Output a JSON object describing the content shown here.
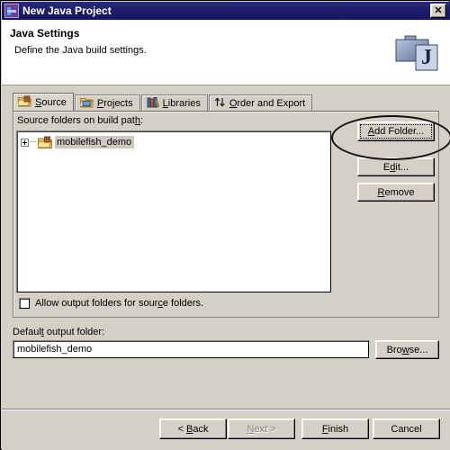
{
  "window": {
    "title": "New Java Project",
    "title_icon": "eclipse-java-icon",
    "close_label": "✕"
  },
  "banner": {
    "title": "Java Settings",
    "subtitle": "Define the Java build settings.",
    "icon": "java-project-briefcase-icon",
    "badge": "J"
  },
  "tabs": [
    {
      "label": "Source",
      "accel": "S",
      "icon": "source-folder-icon",
      "active": true
    },
    {
      "label": "Projects",
      "accel": "P",
      "icon": "projects-folder-icon",
      "active": false
    },
    {
      "label": "Libraries",
      "accel": "L",
      "icon": "libraries-books-icon",
      "active": false
    },
    {
      "label": "Order and Export",
      "accel": "O",
      "icon": "order-updown-arrows-icon",
      "active": false
    }
  ],
  "source_tab": {
    "list_label": "Source folders on build path:",
    "tree_items": [
      {
        "label": "mobilefish_demo",
        "icon": "source-folder-icon",
        "expander": "plus",
        "selected": true
      }
    ],
    "checkbox": {
      "label": "Allow output folders for source folders.",
      "accel": "c",
      "checked": false
    },
    "buttons": [
      {
        "label": "Add Folder...",
        "accel": "A",
        "focused": true,
        "enabled": true
      },
      {
        "label": "Edit...",
        "accel": "d",
        "focused": false,
        "enabled": true
      },
      {
        "label": "Remove",
        "accel": "R",
        "focused": false,
        "enabled": true
      }
    ]
  },
  "output": {
    "label": "Default output folder:",
    "accel": "t",
    "value": "mobilefish_demo",
    "placeholder": "",
    "browse_label": "Browse...",
    "browse_accel": "w"
  },
  "footer": {
    "buttons": [
      {
        "label": "< Back",
        "accel": "B",
        "enabled": true
      },
      {
        "label": "Next >",
        "accel": "N",
        "enabled": false
      },
      {
        "label": "Finish",
        "accel": "F",
        "enabled": true
      },
      {
        "label": "Cancel",
        "accel": "",
        "enabled": true
      }
    ]
  },
  "annotation": {
    "shape": "ellipse",
    "target": "Add Folder...",
    "color": "#111111"
  },
  "colors": {
    "titlebar": "#1d1d6b",
    "face": "#d4d0c8",
    "banner": "#ffffff",
    "selection": "#cdc9c1",
    "folder": "#f5c14b"
  }
}
